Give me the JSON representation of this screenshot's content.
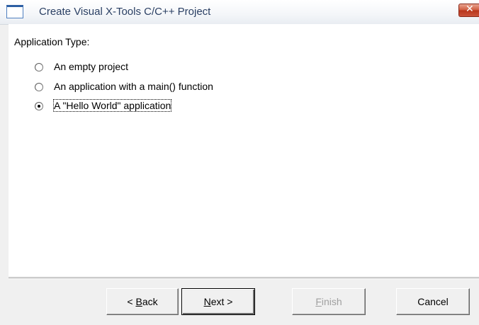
{
  "window": {
    "title": "Create Visual X-Tools C/C++ Project",
    "close_glyph": "✕"
  },
  "application_type": {
    "label": "Application Type:",
    "options": [
      {
        "label": "An empty project",
        "checked": false
      },
      {
        "label": "An application with a main() function",
        "checked": false
      },
      {
        "label": "A \"Hello World\" application",
        "checked": true
      }
    ]
  },
  "buttons": {
    "back": {
      "prefix": "< ",
      "accel": "B",
      "rest": "ack"
    },
    "next": {
      "accel": "N",
      "rest": "ext >"
    },
    "finish": {
      "accel": "F",
      "rest": "inish",
      "disabled": true
    },
    "cancel": {
      "label": "Cancel"
    }
  },
  "icons": {
    "app": "window-frame-icon",
    "close": "close-x-icon"
  },
  "colors": {
    "title_text": "#2a3f63",
    "close_button": "#c9523a",
    "dialog_background": "#f0f0f0",
    "content_background": "#ffffff"
  }
}
